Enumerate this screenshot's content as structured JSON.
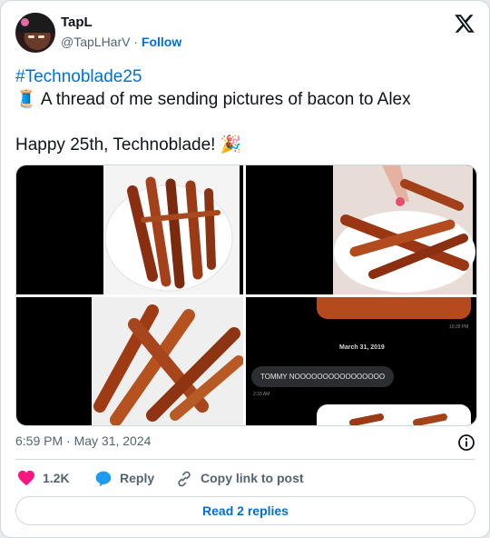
{
  "author": {
    "name": "TapL",
    "handle": "@TapLHarV",
    "separator": "·",
    "follow_label": "Follow"
  },
  "tweet": {
    "hashtag": "#Technoblade25",
    "emoji_thread": "🧵",
    "line1": "A thread of me sending pictures of bacon to Alex",
    "line2": "Happy 25th, Technoblade!",
    "emoji_party": "🎉"
  },
  "media": {
    "chat_date": "March 31, 2019",
    "chat_message": "TOMMY NOOOOOOOOOOOOOOOO",
    "chat_time_top": "10:28 PM",
    "chat_time_msg": "2:33 AM"
  },
  "footer": {
    "timestamp": "6:59 PM · May 31, 2024",
    "like_count": "1.2K",
    "reply_label": "Reply",
    "copy_label": "Copy link to post",
    "read_replies_label": "Read 2 replies"
  },
  "colors": {
    "link": "#006fd6",
    "like": "#f91880",
    "reply": "#1d9bf0",
    "text": "#0f1419",
    "muted": "#536471"
  },
  "icons": [
    "x-logo-icon",
    "info-icon",
    "heart-icon",
    "reply-bubble-icon",
    "link-icon"
  ]
}
